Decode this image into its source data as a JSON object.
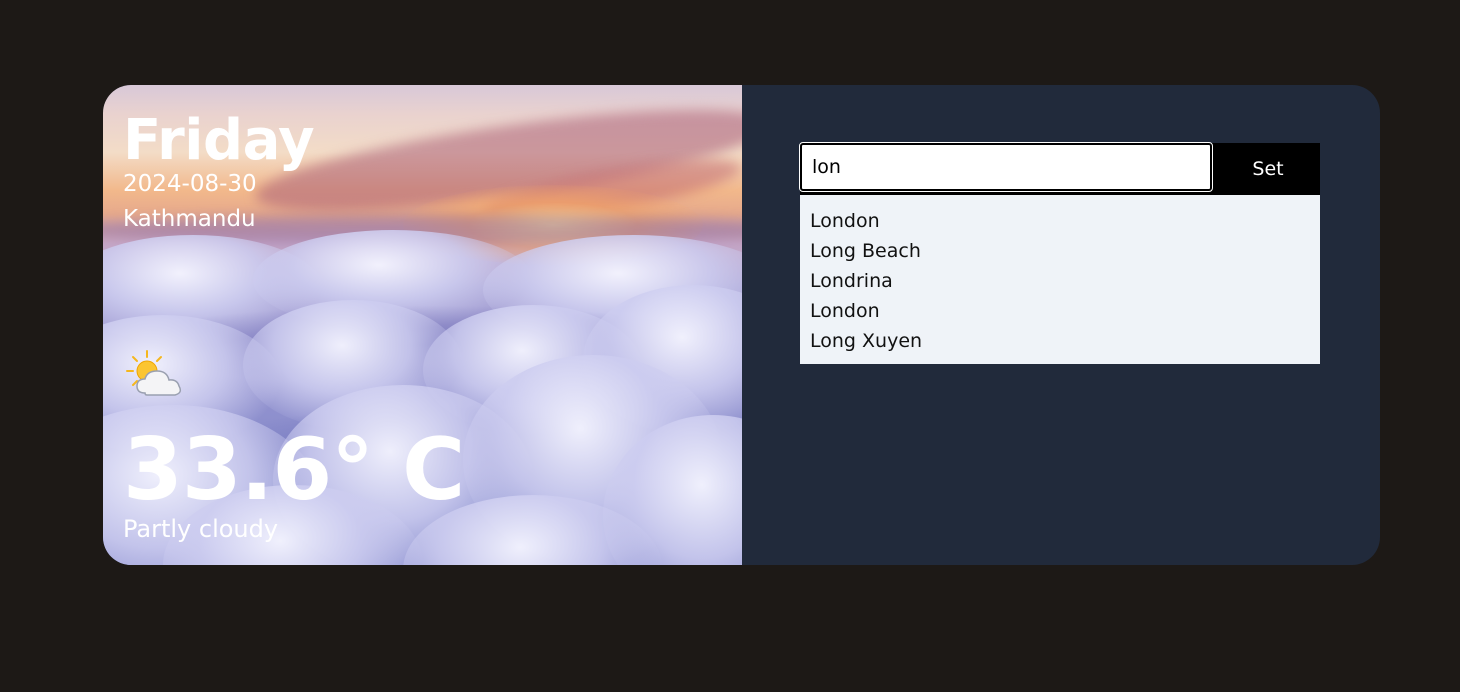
{
  "weather": {
    "day": "Friday",
    "date": "2024-08-30",
    "city": "Kathmandu",
    "icon": "partly-cloudy-icon",
    "temperature": "33.6° C",
    "condition": "Partly cloudy"
  },
  "search": {
    "value": "lon",
    "button_label": "Set",
    "suggestions": [
      "London",
      "Long Beach",
      "Londrina",
      "London",
      "Long Xuyen"
    ]
  },
  "colors": {
    "page_background": "#1d1916",
    "panel_background": "#212a3b",
    "suggestions_background": "#eff3f8",
    "button_background": "#000000"
  }
}
